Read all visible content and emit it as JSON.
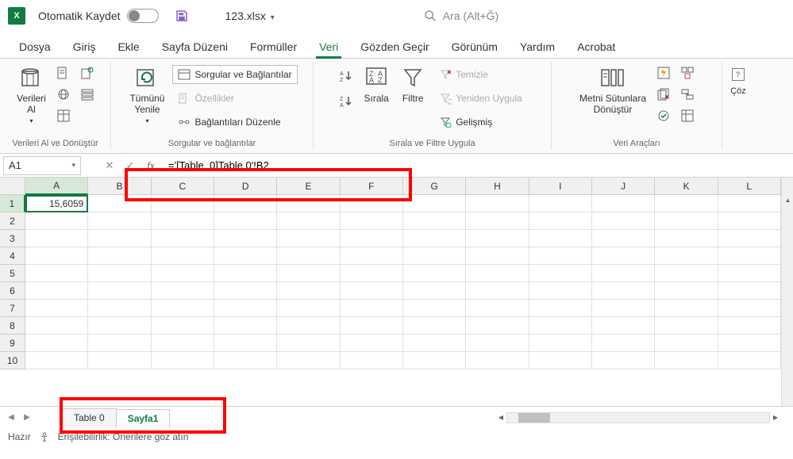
{
  "title": {
    "autosave_label": "Otomatik Kaydet",
    "filename": "123.xlsx",
    "search_placeholder": "Ara (Alt+Ğ)"
  },
  "tabs": {
    "dosya": "Dosya",
    "giris": "Giriş",
    "ekle": "Ekle",
    "sayfa_duzeni": "Sayfa Düzeni",
    "formuller": "Formüller",
    "veri": "Veri",
    "gozden_gecir": "Gözden Geçir",
    "gorunum": "Görünüm",
    "yardim": "Yardım",
    "acrobat": "Acrobat"
  },
  "ribbon": {
    "group1": {
      "verileri_al": "Verileri\nAl",
      "label": "Verileri Al ve Dönüştür"
    },
    "group2": {
      "tumunu_yenile": "Tümünü\nYenile",
      "sorgular": "Sorgular ve Bağlantılar",
      "ozellikler": "Özellikler",
      "baglantilari": "Bağlantıları Düzenle",
      "label": "Sorgular ve bağlantılar"
    },
    "group3": {
      "sirala": "Sırala",
      "filtre": "Filtre",
      "temizle": "Temizle",
      "yeniden": "Yeniden Uygula",
      "gelismis": "Gelişmiş",
      "label": "Sırala ve Filtre Uygula"
    },
    "group4": {
      "metni": "Metni Sütunlara\nDönüştür",
      "label": "Veri Araçları"
    },
    "group5": {
      "coz": "Çöz"
    }
  },
  "formula_bar": {
    "name_box": "A1",
    "formula": "='[Table_0]Table 0'!B2"
  },
  "grid": {
    "cols": [
      "A",
      "B",
      "C",
      "D",
      "E",
      "F",
      "G",
      "H",
      "I",
      "J",
      "K",
      "L"
    ],
    "rows": [
      "1",
      "2",
      "3",
      "4",
      "5",
      "6",
      "7",
      "8",
      "9",
      "10"
    ],
    "cell_a1": "15,6059"
  },
  "sheets": {
    "tab0": "Table 0",
    "tab1": "Sayfa1"
  },
  "status": {
    "hazir": "Hazır",
    "erisilebilirlik": "Erişilebilirlik: Önerilere göz atın"
  }
}
